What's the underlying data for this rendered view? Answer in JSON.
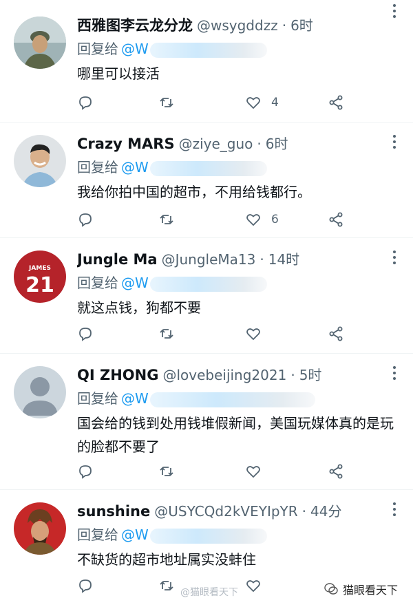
{
  "reply_label": "回复给",
  "reply_to": "@W",
  "tweets": [
    {
      "name": "西雅图李云龙分龙",
      "handle": "@wsygddzz",
      "time": "6时",
      "text": "哪里可以接活",
      "likes": "4",
      "avatar": "military-portrait"
    },
    {
      "name": "Crazy MARS",
      "handle": "@ziye_guo",
      "time": "6时",
      "text": "我给你拍中国的超市，不用给钱都行。",
      "likes": "6",
      "avatar": "smiling-man"
    },
    {
      "name": "Jungle Ma",
      "handle": "@JungleMa13",
      "time": "14时",
      "text": "就这点钱，狗都不要",
      "likes": "",
      "avatar": "jersey-21"
    },
    {
      "name": "QI ZHONG",
      "handle": "@lovebeijing2021",
      "time": "5时",
      "text": "国会给的钱到处用钱堆假新闻，美国玩媒体真的是玩的脸都不要了",
      "likes": "",
      "avatar": "default-user"
    },
    {
      "name": "sunshine",
      "handle": "@USYCQd2kVEYIpYR",
      "time": "44分",
      "text": "不缺货的超市地址属实没蚌住",
      "likes": "",
      "avatar": "warrior-portrait"
    }
  ],
  "watermark_right": "猫眼看天下",
  "watermark_center": "@猫眼看天下"
}
